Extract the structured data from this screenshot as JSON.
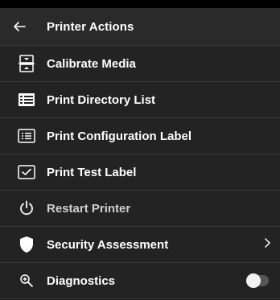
{
  "header": {
    "title": "Printer Actions",
    "back_icon": "arrow-left-icon"
  },
  "items": [
    {
      "label": "Calibrate Media",
      "icon": "calibrate-media-icon"
    },
    {
      "label": "Print Directory List",
      "icon": "directory-list-icon"
    },
    {
      "label": "Print Configuration Label",
      "icon": "configuration-label-icon"
    },
    {
      "label": "Print Test Label",
      "icon": "test-label-icon"
    },
    {
      "label": "Restart Printer",
      "icon": "power-icon"
    },
    {
      "label": "Security Assessment",
      "icon": "shield-icon",
      "trailing": "chevron-right-icon"
    },
    {
      "label": "Diagnostics",
      "icon": "diagnostics-icon",
      "trailing": "toggle",
      "toggle_on": false
    }
  ],
  "colors": {
    "background": "#1c1c1c",
    "header": "#2a2a2a",
    "row": "#232323",
    "divider": "#3a3a3a",
    "text": "#ffffff"
  }
}
